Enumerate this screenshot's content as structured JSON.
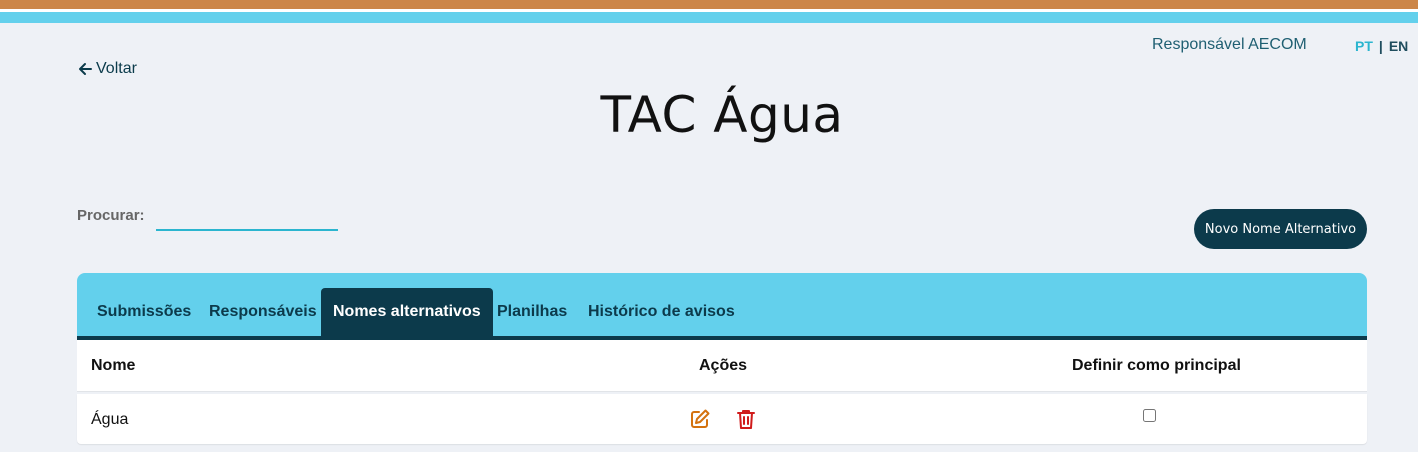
{
  "header": {
    "user": "Responsável AECOM",
    "languages": [
      "PT",
      "EN"
    ],
    "language_separator": "|",
    "colors": {
      "stripe_orange": "#cc8648",
      "stripe_blue": "#63d0ec",
      "dark": "#0c3a4b",
      "accent": "#2bb5cf"
    }
  },
  "back": {
    "label": "Voltar",
    "icon": "arrow-left-icon"
  },
  "page": {
    "title": "TAC Água"
  },
  "search": {
    "label": "Procurar:",
    "value": ""
  },
  "actions": {
    "new_button": "Novo Nome Alternativo"
  },
  "tabs": [
    {
      "label": "Submissões"
    },
    {
      "label": "Responsáveis"
    },
    {
      "label": "Nomes alternativos",
      "active": true
    },
    {
      "label": "Planilhas"
    },
    {
      "label": "Histórico de avisos"
    }
  ],
  "table": {
    "columns": [
      "Nome",
      "Ações",
      "Definir como principal"
    ],
    "rows": [
      {
        "name": "Água",
        "actions": [
          "edit-icon",
          "trash-icon"
        ],
        "principal": false
      }
    ]
  }
}
